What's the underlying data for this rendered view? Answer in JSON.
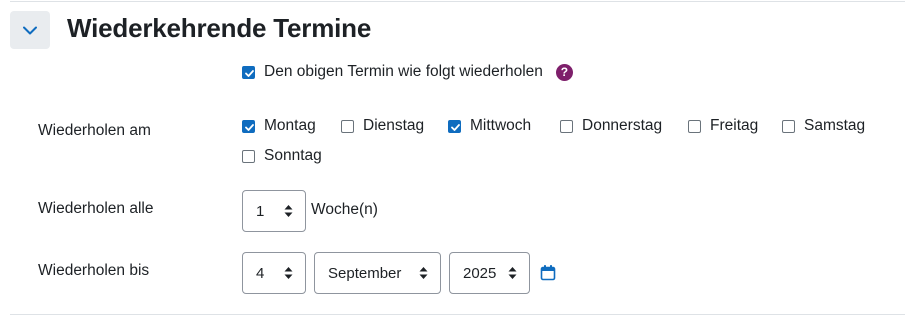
{
  "section": {
    "title": "Wiederkehrende Termine",
    "collapse_icon": "chevron-down-icon"
  },
  "repeat": {
    "label": "Den obigen Termin wie folgt wiederholen",
    "checked": true,
    "help_icon": "?"
  },
  "repeat_on": {
    "label": "Wiederholen am",
    "days": [
      {
        "label": "Montag",
        "checked": true
      },
      {
        "label": "Dienstag",
        "checked": false
      },
      {
        "label": "Mittwoch",
        "checked": true
      },
      {
        "label": "Donnerstag",
        "checked": false
      },
      {
        "label": "Freitag",
        "checked": false
      },
      {
        "label": "Samstag",
        "checked": false
      },
      {
        "label": "Sonntag",
        "checked": false
      }
    ]
  },
  "repeat_every": {
    "label": "Wiederholen alle",
    "value": "1",
    "unit": "Woche(n)"
  },
  "repeat_until": {
    "label": "Wiederholen bis",
    "day": "4",
    "month": "September",
    "year": "2025",
    "calendar_icon": "calendar-icon"
  },
  "colors": {
    "accent": "#0f6cbf",
    "help": "#7e1f6b"
  }
}
